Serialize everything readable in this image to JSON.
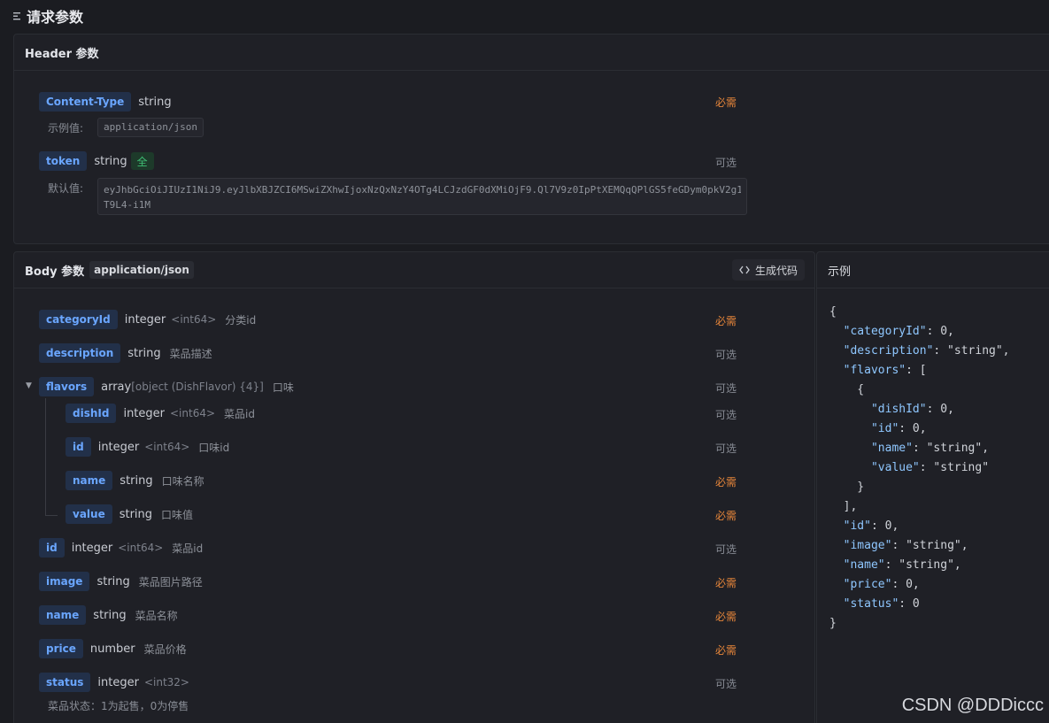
{
  "section_title": "请求参数",
  "header_panel": {
    "title": "Header 参数",
    "params": [
      {
        "name": "Content-Type",
        "type": "string",
        "required_label": "必需",
        "example_label": "示例值:",
        "example_value": "application/json"
      },
      {
        "name": "token",
        "type": "string",
        "badge": "全",
        "required_label": "可选",
        "default_label": "默认值:",
        "default_value_line1": "eyJhbGciOiJIUzI1NiJ9.eyJlbXBJZCI6MSwiZXhwIjoxNzQxNzY4OTg4LCJzdGF0dXMiOjF9.Ql7V9z0IpPtXEMQqQPlGS5feGDym0pkV2g1",
        "default_value_line2": "T9L4-i1M"
      }
    ]
  },
  "body_panel": {
    "title": "Body 参数",
    "mime": "application/json",
    "gen_code_label": "生成代码",
    "params": [
      {
        "name": "categoryId",
        "type": "integer",
        "format": "<int64>",
        "desc": "分类id",
        "status": "必需"
      },
      {
        "name": "description",
        "type": "string",
        "format": "",
        "desc": "菜品描述",
        "status": "可选"
      },
      {
        "name": "flavors",
        "type": "array",
        "format": "[object (DishFlavor) {4}]",
        "desc": "口味",
        "status": "可选"
      },
      {
        "name": "dishId",
        "type": "integer",
        "format": "<int64>",
        "desc": "菜品id",
        "status": "可选"
      },
      {
        "name": "id",
        "type": "integer",
        "format": "<int64>",
        "desc": "口味id",
        "status": "可选"
      },
      {
        "name": "name",
        "type": "string",
        "format": "",
        "desc": "口味名称",
        "status": "必需"
      },
      {
        "name": "value",
        "type": "string",
        "format": "",
        "desc": "口味值",
        "status": "必需"
      },
      {
        "name": "id",
        "type": "integer",
        "format": "<int64>",
        "desc": "菜品id",
        "status": "可选"
      },
      {
        "name": "image",
        "type": "string",
        "format": "",
        "desc": "菜品图片路径",
        "status": "必需"
      },
      {
        "name": "name",
        "type": "string",
        "format": "",
        "desc": "菜品名称",
        "status": "必需"
      },
      {
        "name": "price",
        "type": "number",
        "format": "",
        "desc": "菜品价格",
        "status": "必需"
      },
      {
        "name": "status",
        "type": "integer",
        "format": "<int32>",
        "desc": "",
        "status": "可选"
      }
    ],
    "status_note": "菜品状态：1为起售，0为停售"
  },
  "example_panel": {
    "title": "示例",
    "lines": [
      "{",
      "  \"categoryId\": 0,",
      "  \"description\": \"string\",",
      "  \"flavors\": [",
      "    {",
      "      \"dishId\": 0,",
      "      \"id\": 0,",
      "      \"name\": \"string\",",
      "      \"value\": \"string\"",
      "    }",
      "  ],",
      "  \"id\": 0,",
      "  \"image\": \"string\",",
      "  \"name\": \"string\",",
      "  \"price\": 0,",
      "  \"status\": 0",
      "}"
    ]
  },
  "watermark": "CSDN @DDDiccc",
  "colors": {
    "background": "#1b1c21",
    "chip_text": "#6aa6ff",
    "required": "#e5853a",
    "optional": "#878b94",
    "badge_green": "#3fbf74"
  }
}
